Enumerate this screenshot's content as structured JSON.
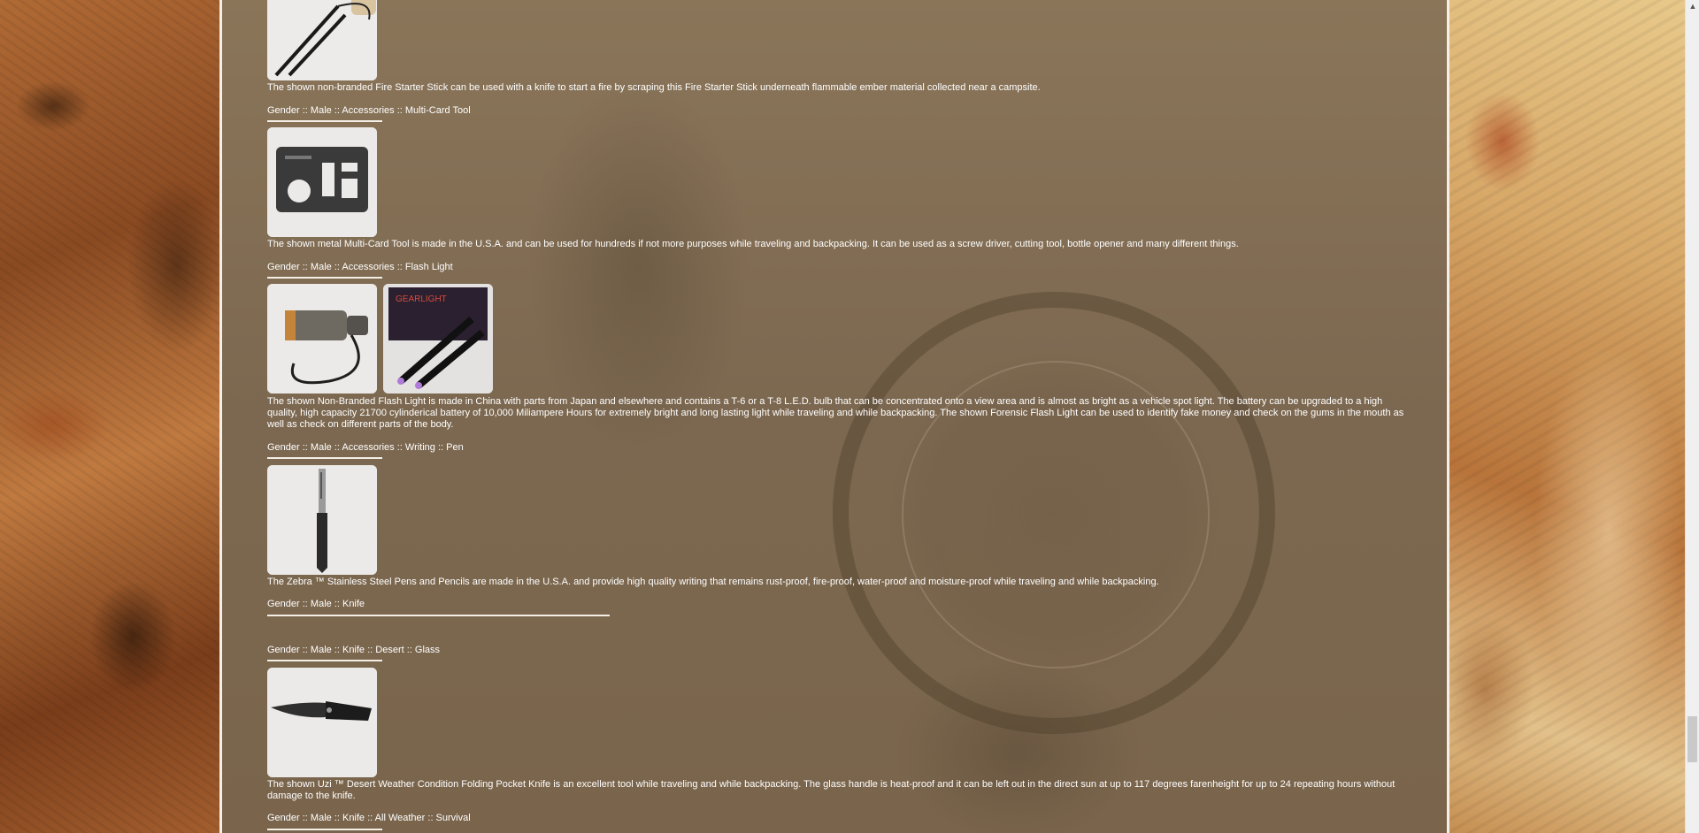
{
  "sections": [
    {
      "category": "",
      "images": [
        "fire-starter-stick-image"
      ],
      "description": "The shown non-branded Fire Starter Stick can be used with a knife to start a fire by scraping this Fire Starter Stick underneath flammable ember material collected near a campsite."
    },
    {
      "category": "Gender :: Male :: Accessories :: Multi-Card Tool",
      "images": [
        "multi-card-tool-image"
      ],
      "description": "The shown metal Multi-Card Tool is made in the U.S.A. and can be used for hundreds if not more purposes while traveling and backpacking. It can be used as a screw driver, cutting tool, bottle opener and many different things."
    },
    {
      "category": "Gender :: Male :: Accessories :: Flash Light",
      "images": [
        "flash-light-image",
        "forensic-flash-light-image"
      ],
      "description": "The shown Non-Branded Flash Light is made in China with parts from Japan and elsewhere and contains a T-6 or a T-8 L.E.D. bulb that can be concentrated onto a view area and is almost as bright as a vehicle spot light. The battery can be upgraded to a high quality, high capacity 21700 cylinderical battery of 10,000 Miliampere Hours for extremely bright and long lasting light while traveling and while backpacking. The shown Forensic Flash Light can be used to identify fake money and check on the gums in the mouth as well as check on different parts of the body."
    },
    {
      "category": "Gender :: Male :: Accessories :: Writing :: Pen",
      "images": [
        "zebra-pen-image"
      ],
      "description": "The Zebra ™ Stainless Steel Pens and Pencils are made in the U.S.A. and provide high quality writing that remains rust-proof, fire-proof, water-proof and moisture-proof while traveling and while backpacking."
    },
    {
      "category": "Gender :: Male :: Knife",
      "images": [],
      "description": ""
    },
    {
      "category": "Gender :: Male :: Knife :: Desert :: Glass",
      "images": [
        "uzi-pocket-knife-image"
      ],
      "description": "The shown Uzi ™ Desert Weather Condition Folding Pocket Knife is an excellent tool while traveling and while backpacking. The glass handle is heat-proof and it can be left out in the direct sun at up to 117 degrees farenheight for up to 24 repeating hours without damage to the knife."
    },
    {
      "category": "Gender :: Male :: Knife :: All Weather :: Survival",
      "images": [],
      "description": ""
    }
  ],
  "colors": {
    "text": "#ffffff",
    "panel_border": "#f4efe6",
    "thumb_bg": "#e9e6e4"
  }
}
